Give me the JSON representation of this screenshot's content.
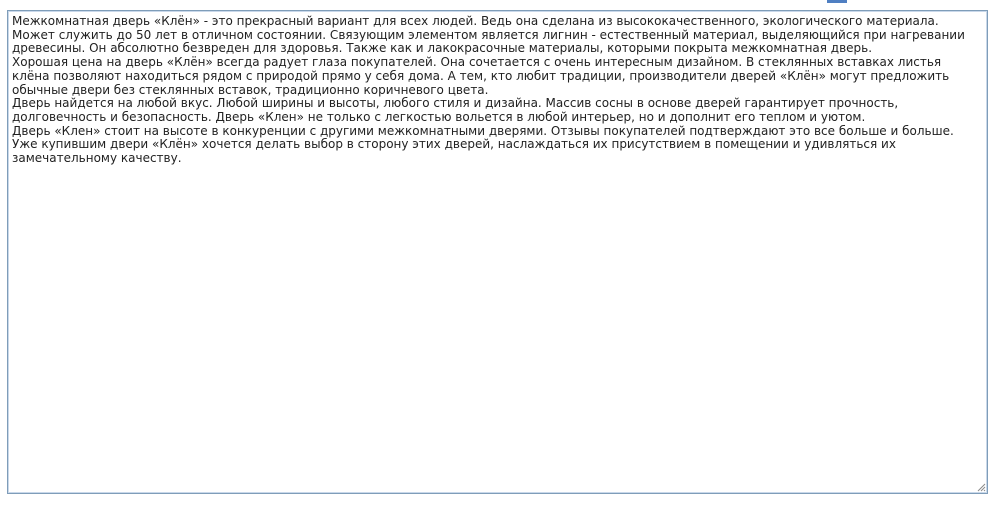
{
  "editor": {
    "lines": [
      "Межкомнатная дверь «Клён» - это прекрасный вариант для всех людей. Ведь она сделана из высококачественного, экологического материала.",
      "Может служить до 50 лет в отличном состоянии.  Связующим элементом является лигнин - естественный материал, выделяющийся при нагревании древесины. Он абсолютно безвреден для здоровья. Также как и лакокрасочные материалы, которыми покрыта межкомнатная дверь.",
      "Хорошая цена на дверь «Клён» всегда радует глаза покупателей. Она сочетается с очень интересным дизайном. В стеклянных вставках листья клёна позволяют находиться рядом с природой прямо у себя дома. А тем, кто любит традиции, производители дверей «Клён» могут предложить обычные двери без стеклянных вставок, традиционно коричневого цвета.",
      "Дверь найдется на любой вкус. Любой ширины и высоты, любого стиля и дизайна. Массив сосны в основе дверей гарантирует прочность, долговечность и безопасность. Дверь «Клен» не только с легкостью вольется в любой интерьер, но и дополнит его теплом и уютом.",
      "Дверь «Клен» стоит на высоте в конкуренции с другими межкомнатными дверями. Отзывы покупателей подтверждают это все больше и больше.",
      "Уже купившим двери «Клён» хочется делать выбор в сторону этих дверей, наслаждаться их присутствием в помещении и удивляться их замечательному качеству."
    ]
  },
  "icons": {
    "resize": "resize-grip-icon"
  },
  "colors": {
    "border": "#7f9db9",
    "text": "#222222"
  }
}
